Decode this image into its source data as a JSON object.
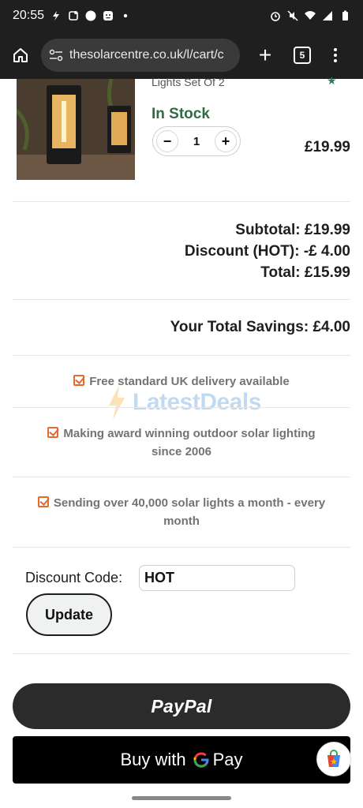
{
  "status_bar": {
    "time": "20:55"
  },
  "browser": {
    "url": "thesolarcentre.co.uk/l/cart/c",
    "tab_count": "5",
    "new_tab_glyph": "+"
  },
  "product": {
    "title": "Lights Set Of 2",
    "stock_status": "In Stock",
    "quantity": "1",
    "decrement_label": "−",
    "increment_label": "+",
    "price": "£19.99"
  },
  "totals": {
    "subtotal": "Subtotal:  £19.99",
    "discount": "Discount (HOT): -£ 4.00",
    "total": "Total:  £15.99"
  },
  "savings": "Your Total Savings:  £4.00",
  "benefits": [
    "Free standard UK delivery available",
    "Making award winning outdoor solar lighting since 2006",
    "Sending over 40,000 solar lights a month - every month"
  ],
  "watermark": {
    "text": "LatestDeals",
    "color": "#3f8ed6"
  },
  "discount_code": {
    "label": "Discount Code:",
    "value": "HOT",
    "update_label": "Update"
  },
  "checkout": {
    "paypal_label": "PayPal",
    "gpay_prefix": "Buy with",
    "gpay_suffix": "Pay"
  },
  "colors": {
    "stock_green": "#2e6b46",
    "check_orange": "#e56a2b",
    "paypal_bg": "#2b2b2c"
  },
  "icons": [
    "home-icon",
    "site-info-icon",
    "plus-icon",
    "tabs-icon",
    "more-vert-icon",
    "checkbox-icon",
    "google-g-icon",
    "cart-shop-icon"
  ]
}
